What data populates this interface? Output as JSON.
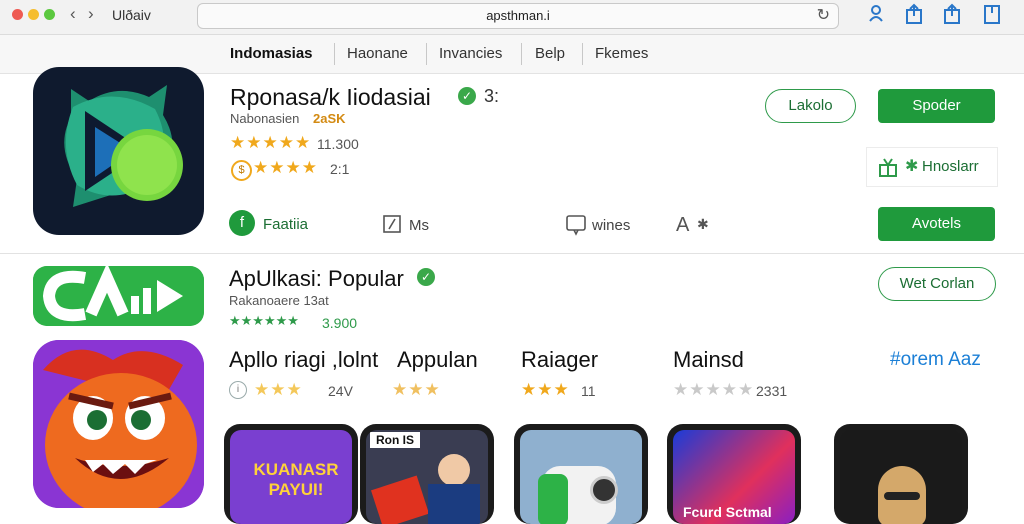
{
  "window": {
    "title": "Ulðaiv",
    "url": "apsthman.i"
  },
  "tabs": [
    {
      "label": "Indomasias"
    },
    {
      "label": "Haonane"
    },
    {
      "label": "Invancies"
    },
    {
      "label": "Belp"
    },
    {
      "label": "Fkemes"
    }
  ],
  "app1": {
    "title": "Rponasa/k Iiodasiai",
    "title_suffix": "3:",
    "subtitle": "Nabonasien",
    "subtitle_tag": "2aSK",
    "rating1_stars": "★★★★★",
    "rating1_count": "11.300",
    "rating2_stars": "★★★★",
    "rating2_count": "2:1",
    "open_button": "Lakolo",
    "primary_button": "Spoder",
    "wishlist_label": "Hnoslarr",
    "meta_developer": "Faatiia",
    "meta_size": "Ms",
    "meta_device": "wines",
    "meta_age": "A",
    "secondary_button": "Avotels"
  },
  "app2": {
    "title": "ApUlkasi: Popular",
    "subtitle": "Rakanoaere 13at",
    "stars": "★★★★★★",
    "count": "3.900",
    "outline_button": "Wet Corlan"
  },
  "columns": [
    {
      "title": "Apllo riagi ,lolnt",
      "stars": "★★★",
      "count": "24V"
    },
    {
      "title": "Appulan",
      "stars": "★★★",
      "count": ""
    },
    {
      "title": "Raiager",
      "stars": "★★★",
      "count": "11"
    },
    {
      "title": "Mainsd",
      "stars": "★★★★★",
      "count": "2331"
    }
  ],
  "see_all_link": "#orem Aaz",
  "phones": [
    {
      "caption": "KUANASR PAYUI!"
    },
    {
      "caption": "Ron IS"
    },
    {
      "caption": ""
    },
    {
      "caption": "Fcurd Sctmal"
    },
    {
      "caption": ""
    }
  ],
  "colors": {
    "accent_green": "#1f9a3c",
    "star": "#f0a81c",
    "link_blue": "#1b7fd6"
  }
}
